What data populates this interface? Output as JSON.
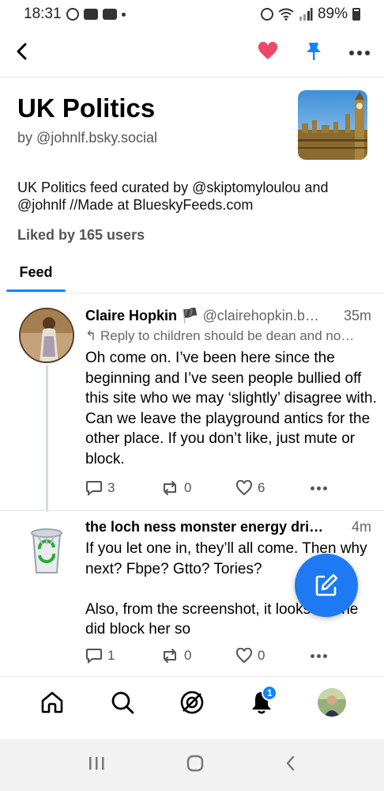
{
  "status_bar": {
    "time": "18:31",
    "battery": "89%"
  },
  "feed": {
    "title": "UK Politics",
    "by": "by @johnlf.bsky.social",
    "description": "UK Politics feed curated by @skiptomyloulou and @johnlf //Made at BlueskyFeeds.com",
    "liked_by": "Liked by 165 users",
    "tab": "Feed"
  },
  "posts": [
    {
      "name": "Claire Hopkin",
      "flag": "🏴",
      "handle": "@clairehopkin.b…",
      "time": "35m",
      "reply_to": "Reply to children should be dean and no…",
      "text": "Oh come on. I’ve been here since the beginning and I’ve seen people bullied off this site who we may ‘slightly’ disagree with. Can we leave the playground antics for the other place. If you don’t like, just mute or block.",
      "replies": "3",
      "reposts": "0",
      "likes": "6"
    },
    {
      "name": "the loch ness monster energy dri…",
      "time": "4m",
      "text": "If you let one in, they’ll all come. Then why next? Fbpe? Gtto? Tories?\n\nAlso, from the screenshot, it looks like he did block her so",
      "replies": "1",
      "reposts": "0",
      "likes": "0"
    }
  ],
  "bottom_nav": {
    "notification_count": "1"
  },
  "colors": {
    "accent": "#1083fe",
    "like": "#ec4868",
    "fab": "#1d7af2"
  }
}
